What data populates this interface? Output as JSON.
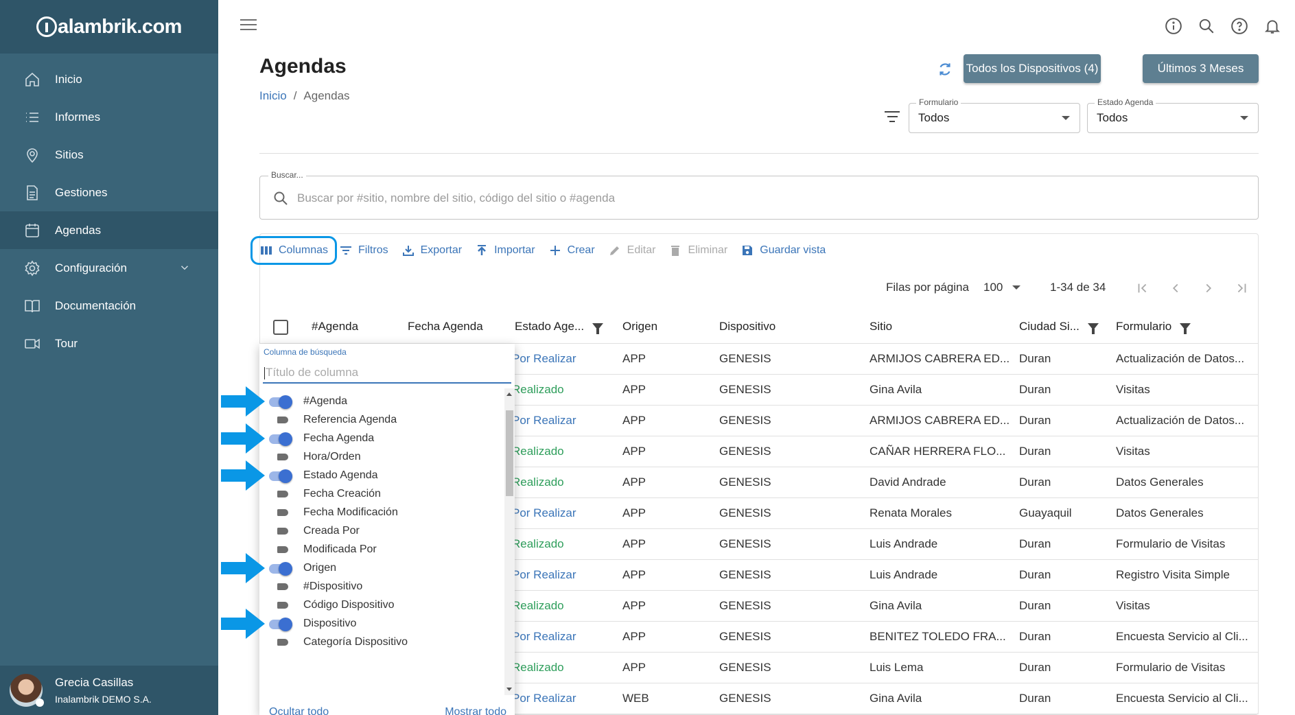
{
  "brand": {
    "logo_text": "alambrik.com",
    "logo_prefix": "in"
  },
  "sidebar": {
    "items": [
      {
        "label": "Inicio",
        "icon": "home-icon"
      },
      {
        "label": "Informes",
        "icon": "list-icon"
      },
      {
        "label": "Sitios",
        "icon": "location-pin-icon"
      },
      {
        "label": "Gestiones",
        "icon": "document-icon"
      },
      {
        "label": "Agendas",
        "icon": "calendar-icon",
        "active": true
      },
      {
        "label": "Configuración",
        "icon": "gear-icon",
        "expandable": true
      },
      {
        "label": "Documentación",
        "icon": "book-icon"
      },
      {
        "label": "Tour",
        "icon": "video-camera-icon"
      }
    ],
    "user": {
      "name": "Grecia Casillas",
      "org": "Inalambrik DEMO S.A."
    }
  },
  "header": {
    "icons": [
      "info-icon",
      "search-icon",
      "help-icon",
      "bell-icon"
    ],
    "title": "Agendas",
    "breadcrumb": {
      "home": "Inicio",
      "separator": "/",
      "current": "Agendas"
    },
    "btn_devices": "Todos los Dispositivos (4)",
    "btn_months": "Últimos 3 Meses"
  },
  "filters": {
    "formulario": {
      "label": "Formulario",
      "value": "Todos"
    },
    "estado": {
      "label": "Estado Agenda",
      "value": "Todos"
    }
  },
  "search": {
    "label": "Buscar...",
    "placeholder": "Buscar por #sitio, nombre del sitio, código del sitio o #agenda"
  },
  "toolbar": {
    "columnas": "Columnas",
    "filtros": "Filtros",
    "exportar": "Exportar",
    "importar": "Importar",
    "crear": "Crear",
    "editar": "Editar",
    "eliminar": "Eliminar",
    "guardar": "Guardar vista"
  },
  "pager": {
    "rows_label": "Filas por página",
    "rows_value": "100",
    "range": "1-34 de 34"
  },
  "table": {
    "headers": {
      "agenda": "#Agenda",
      "fecha": "Fecha Agenda",
      "estado": "Estado Age...",
      "origen": "Origen",
      "dispositivo": "Dispositivo",
      "sitio": "Sitio",
      "ciudad": "Ciudad Si...",
      "formulario": "Formulario"
    },
    "rows": [
      {
        "estado": "Por Realizar",
        "origen": "APP",
        "dispositivo": "GENESIS",
        "sitio": "ARMIJOS CABRERA ED...",
        "ciudad": "Duran",
        "formulario": "Actualización de Datos..."
      },
      {
        "estado": "Realizado",
        "origen": "APP",
        "dispositivo": "GENESIS",
        "sitio": "Gina Avila",
        "ciudad": "Duran",
        "formulario": "Visitas"
      },
      {
        "estado": "Por Realizar",
        "origen": "APP",
        "dispositivo": "GENESIS",
        "sitio": "ARMIJOS CABRERA ED...",
        "ciudad": "Duran",
        "formulario": "Actualización de Datos..."
      },
      {
        "estado": "Realizado",
        "origen": "APP",
        "dispositivo": "GENESIS",
        "sitio": "CAÑAR HERRERA FLO...",
        "ciudad": "Duran",
        "formulario": "Visitas"
      },
      {
        "estado": "Realizado",
        "origen": "APP",
        "dispositivo": "GENESIS",
        "sitio": "David Andrade",
        "ciudad": "Duran",
        "formulario": "Datos Generales"
      },
      {
        "estado": "Por Realizar",
        "origen": "APP",
        "dispositivo": "GENESIS",
        "sitio": "Renata Morales",
        "ciudad": "Guayaquil",
        "formulario": "Datos Generales"
      },
      {
        "estado": "Realizado",
        "origen": "APP",
        "dispositivo": "GENESIS",
        "sitio": "Luis Andrade",
        "ciudad": "Duran",
        "formulario": "Formulario de Visitas"
      },
      {
        "estado": "Por Realizar",
        "origen": "APP",
        "dispositivo": "GENESIS",
        "sitio": "Luis Andrade",
        "ciudad": "Duran",
        "formulario": "Registro Visita Simple"
      },
      {
        "estado": "Realizado",
        "origen": "APP",
        "dispositivo": "GENESIS",
        "sitio": "Gina Avila",
        "ciudad": "Duran",
        "formulario": "Visitas"
      },
      {
        "estado": "Por Realizar",
        "origen": "APP",
        "dispositivo": "GENESIS",
        "sitio": "BENITEZ TOLEDO FRA...",
        "ciudad": "Duran",
        "formulario": "Encuesta Servicio al Cli..."
      },
      {
        "estado": "Realizado",
        "origen": "APP",
        "dispositivo": "GENESIS",
        "sitio": "Luis Lema",
        "ciudad": "Duran",
        "formulario": "Formulario de Visitas"
      },
      {
        "estado": "Por Realizar",
        "origen": "WEB",
        "dispositivo": "GENESIS",
        "sitio": "Gina Avila",
        "ciudad": "Duran",
        "formulario": "Encuesta Servicio al Cli..."
      }
    ]
  },
  "column_chooser": {
    "search_label": "Columna de búsqueda",
    "search_placeholder": "Título de columna",
    "columns": [
      {
        "label": "#Agenda",
        "on": true
      },
      {
        "label": "Referencia Agenda",
        "on": false
      },
      {
        "label": "Fecha Agenda",
        "on": true
      },
      {
        "label": "Hora/Orden",
        "on": false
      },
      {
        "label": "Estado Agenda",
        "on": true
      },
      {
        "label": "Fecha Creación",
        "on": false
      },
      {
        "label": "Fecha Modificación",
        "on": false
      },
      {
        "label": "Creada Por",
        "on": false
      },
      {
        "label": "Modificada Por",
        "on": false
      },
      {
        "label": "Origen",
        "on": true
      },
      {
        "label": "#Dispositivo",
        "on": false
      },
      {
        "label": "Código Dispositivo",
        "on": false
      },
      {
        "label": "Dispositivo",
        "on": true
      },
      {
        "label": "Categoría Dispositivo",
        "on": false
      }
    ],
    "hide_all": "Ocultar todo",
    "show_all": "Mostrar todo"
  },
  "colors": {
    "sidebar": "#3a6478",
    "accent": "#3b75b8",
    "done": "#2e9e5b",
    "highlight": "#0a97e6"
  }
}
